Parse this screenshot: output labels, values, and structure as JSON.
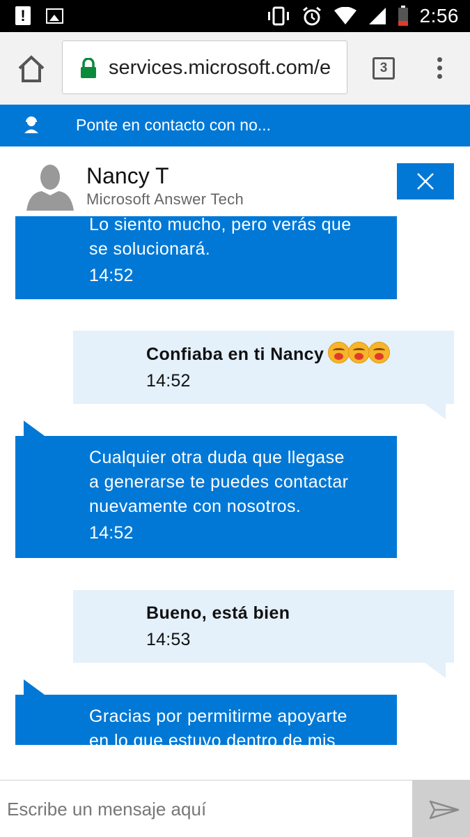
{
  "status_bar": {
    "time": "2:56",
    "left_icons": [
      "alert-icon",
      "image-icon"
    ],
    "right_icons": [
      "vibrate-icon",
      "alarm-icon",
      "wifi-icon",
      "signal-icon",
      "battery-icon"
    ]
  },
  "browser": {
    "url": "services.microsoft.com/e",
    "tab_count": "3",
    "icons": [
      "home-icon",
      "lock-icon",
      "overflow-menu-icon"
    ]
  },
  "page_header": {
    "title": "Ponte en contacto con no..."
  },
  "agent": {
    "name": "Nancy T",
    "role": "Microsoft Answer Tech"
  },
  "messages": [
    {
      "from": "agent",
      "lines": [
        "Lo siento mucho, pero verás que",
        "se solucionará."
      ],
      "time": "14:52"
    },
    {
      "from": "user",
      "lines": [
        "Confiaba en ti Nancy"
      ],
      "emoji_count": 3,
      "time": "14:52"
    },
    {
      "from": "agent",
      "lines": [
        "Cualquier otra duda que llegase",
        "a generarse te puedes contactar",
        "nuevamente con nosotros."
      ],
      "time": "14:52"
    },
    {
      "from": "user",
      "lines": [
        "Bueno, está bien"
      ],
      "time": "14:53"
    },
    {
      "from": "agent",
      "lines": [
        "Gracias por permitirme apoyarte",
        "en lo que estuvo dentro de mis"
      ],
      "time": ""
    }
  ],
  "composer": {
    "placeholder": "Escribe un mensaje aquí"
  },
  "colors": {
    "accent": "#0178d6",
    "user_bubble": "#e4f0fa",
    "toolbar": "#f2f2f2"
  }
}
